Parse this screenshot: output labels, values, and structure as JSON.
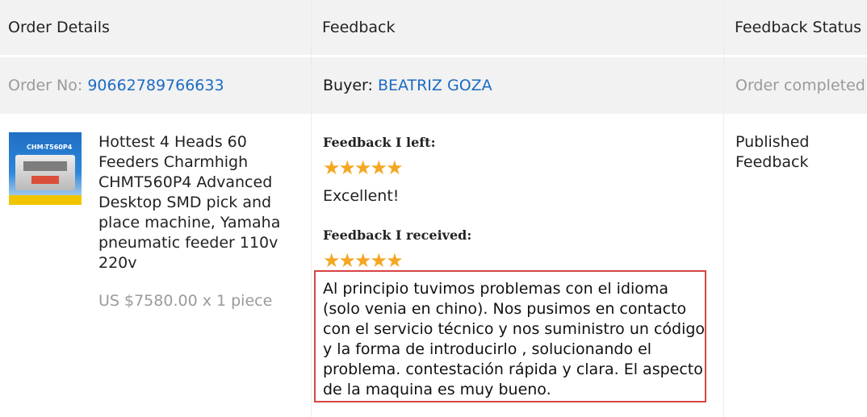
{
  "columns": {
    "order_details": "Order Details",
    "feedback": "Feedback",
    "feedback_status": "Feedback Status"
  },
  "order": {
    "order_no_label": "Order No:",
    "order_no": "90662789766633",
    "buyer_label": "Buyer:",
    "buyer_name": "BEATRIZ GOZA",
    "status": "Order completed"
  },
  "product": {
    "image_caption": "CHM-T560P4",
    "title": "Hottest 4 Heads 60\nFeeders Charmhigh\nCHMT560P4 Advanced\nDesktop SMD pick and\nplace machine, Yamaha\npneumatic feeder 110v\n220v",
    "price": "US $7580.00 x 1 piece"
  },
  "feedback": {
    "left_label": "Feedback I left:",
    "left_rating": 5,
    "left_text": "Excellent!",
    "received_label": "Feedback I received:",
    "received_rating": 5,
    "received_text": "Al principio tuvimos problemas con el idioma\n(solo venia en chino). Nos pusimos en contacto\ncon el servicio técnico y nos suministro un código\ny la forma de introducirlo , solucionando el\nproblema. contestación rápida y clara. El aspecto\nde la maquina es muy bueno."
  },
  "feedback_status": {
    "value": "Published\nFeedback"
  },
  "colors": {
    "link": "#1b6bc4",
    "star": "#f5a623",
    "highlight_border": "#d64545"
  },
  "icons": {
    "star": "star-icon"
  }
}
